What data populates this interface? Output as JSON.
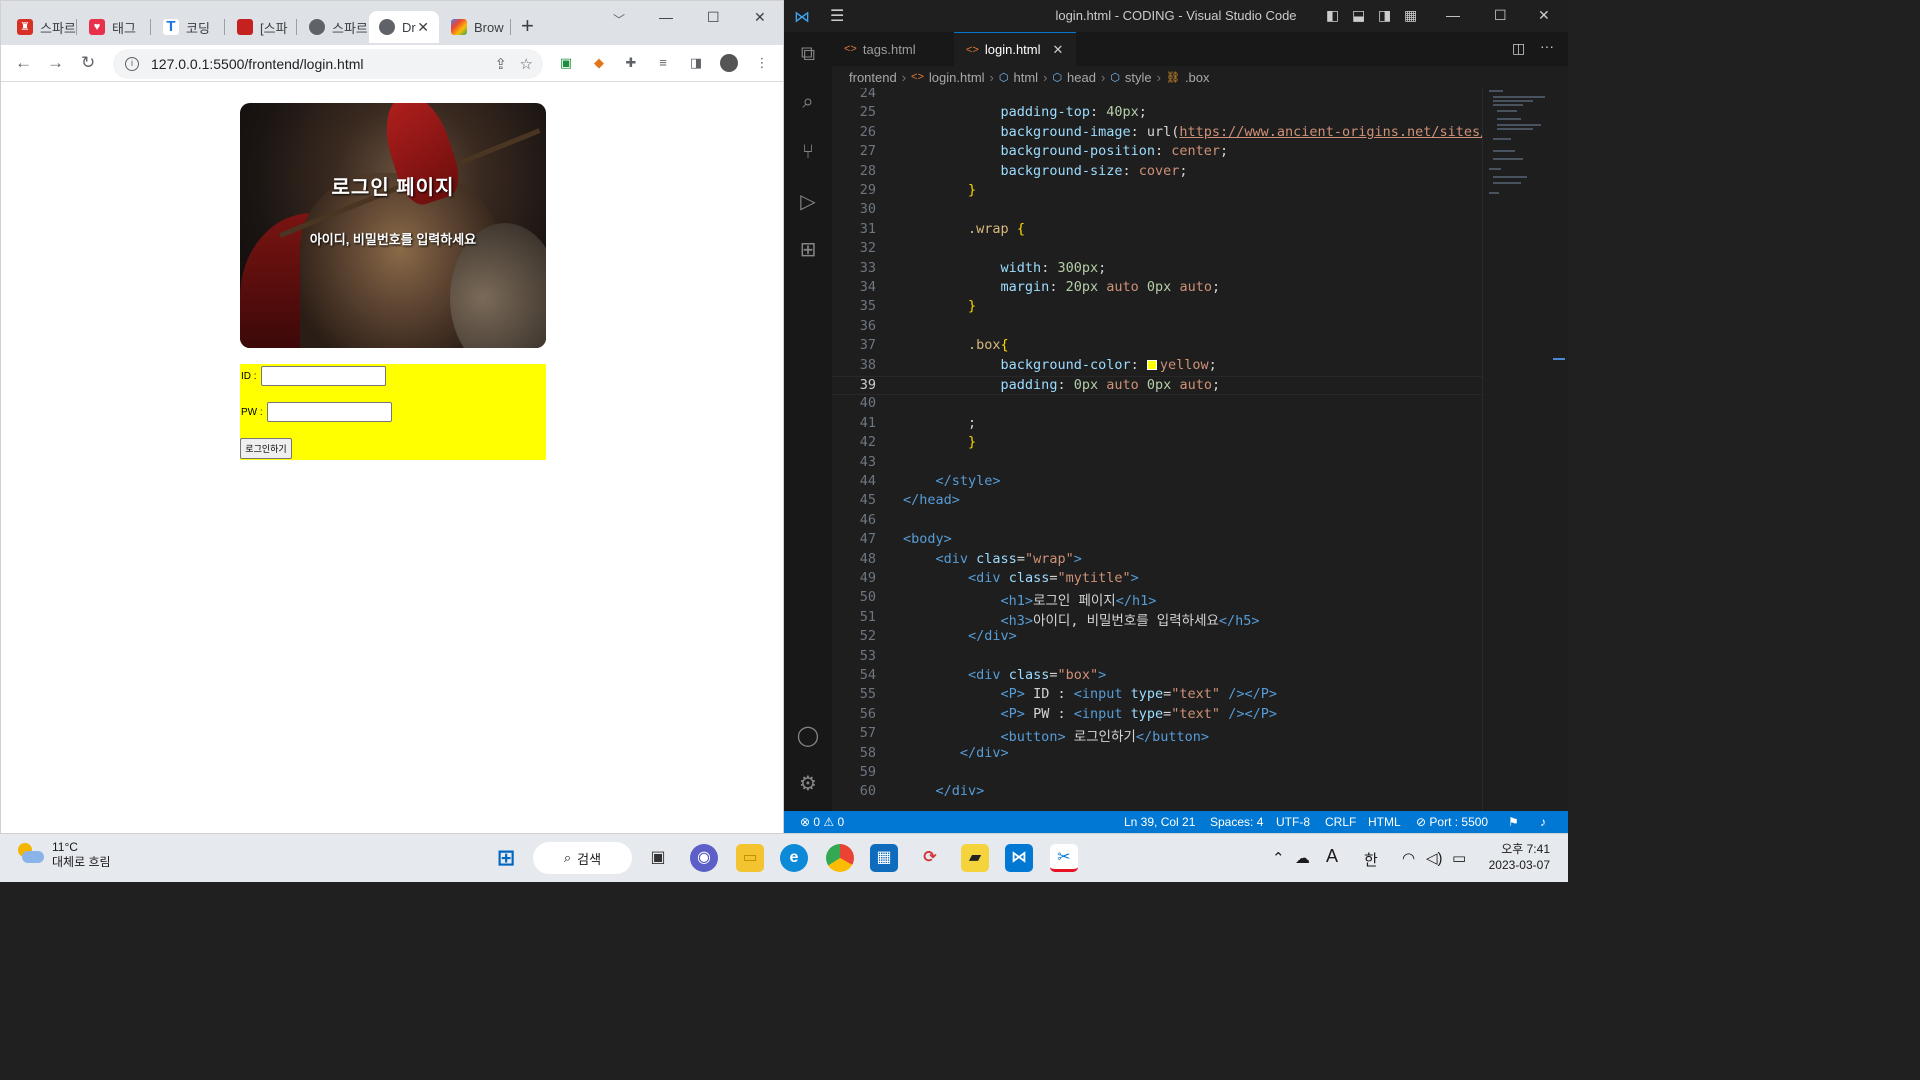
{
  "browser": {
    "tabs": [
      {
        "label": "스파르",
        "color": "#d93025",
        "glyph": "♜"
      },
      {
        "label": "태그",
        "color": "#e8304a",
        "glyph": "♥"
      },
      {
        "label": "코딩",
        "color": "#1a73e8",
        "glyph": "T"
      },
      {
        "label": "[스파",
        "color": "#c5221f",
        "glyph": "■"
      },
      {
        "label": "스파르",
        "color": "#5f6368",
        "glyph": "◍"
      },
      {
        "label": "Dr",
        "color": "#5f6368",
        "glyph": "◍"
      },
      {
        "label": "Brow",
        "color": "#4285f4",
        "glyph": "◆"
      }
    ],
    "new_tab": "+",
    "url": "127.0.0.1:5500/frontend/login.html"
  },
  "page": {
    "title": "로그인 페이지",
    "subtitle": "아이디, 비밀번호를 입력하세요",
    "id_label": "ID :",
    "pw_label": "PW :",
    "login_button": "로그인하기"
  },
  "vscode": {
    "window_title": "login.html - CODING - Visual Studio Code",
    "tabs": [
      "tags.html",
      "login.html"
    ],
    "breadcrumb": [
      "frontend",
      "login.html",
      "html",
      "head",
      "style",
      ".box"
    ],
    "status": {
      "problems": "⊗ 0 ⚠ 0",
      "position": "Ln 39, Col 21",
      "spaces": "Spaces: 4",
      "encoding": "UTF-8",
      "eol": "CRLF",
      "language": "HTML",
      "port": "⊘ Port : 5500"
    }
  },
  "taskbar": {
    "temperature": "11°C",
    "weather": "대체로 흐림",
    "search_label": "검색",
    "time": "오후 7:41",
    "date": "2023-03-07",
    "ime": "한"
  }
}
